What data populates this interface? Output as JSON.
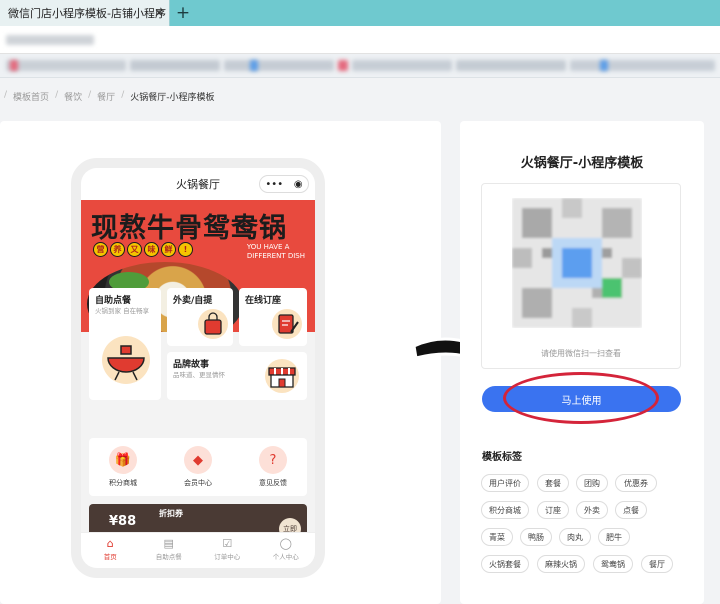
{
  "browser": {
    "tab_title": "微信门店小程序模板-店铺小程序",
    "tab_close": "✕",
    "new_tab": "+"
  },
  "breadcrumb": [
    "模板首页",
    "餐饮",
    "餐厅",
    "火锅餐厅-小程序模板"
  ],
  "phone": {
    "nav_title": "火锅餐厅",
    "capsule_more": "•••",
    "capsule_close": "◉",
    "banner": {
      "title": "现熬牛骨鸳鸯锅",
      "tags": [
        "营",
        "养",
        "又",
        "味",
        "鲜",
        "!"
      ],
      "en_line1": "YOU HAVE A",
      "en_line2": "DIFFERENT DISH"
    },
    "tiles": [
      {
        "title": "自助点餐",
        "sub": "火锅到家 自在畅享"
      },
      {
        "title": "外卖/自提",
        "sub": ""
      },
      {
        "title": "在线订座",
        "sub": ""
      },
      {
        "title": "品牌故事",
        "sub": "品味道、更显情怀"
      }
    ],
    "quick": [
      {
        "label": "积分商城",
        "icon": "gift-icon",
        "glyph": "🎁"
      },
      {
        "label": "会员中心",
        "icon": "diamond-icon",
        "glyph": "◆"
      },
      {
        "label": "意见反馈",
        "icon": "question-icon",
        "glyph": "?"
      }
    ],
    "coupon": {
      "value": "¥88",
      "title": "折扣券",
      "badge": "立即"
    },
    "tabbar": [
      {
        "label": "首页",
        "glyph": "⌂",
        "active": true
      },
      {
        "label": "自助点餐",
        "glyph": "▤",
        "active": false
      },
      {
        "label": "订单中心",
        "glyph": "☑",
        "active": false
      },
      {
        "label": "个人中心",
        "glyph": "◯",
        "active": false
      }
    ]
  },
  "info": {
    "title": "火锅餐厅-小程序模板",
    "qr_caption": "请使用微信扫一扫查看",
    "use_button": "马上使用",
    "tags_heading": "模板标签",
    "tags": [
      "用户评价",
      "套餐",
      "团购",
      "优惠券",
      "积分商城",
      "订座",
      "外卖",
      "点餐",
      "青菜",
      "鸭肠",
      "肉丸",
      "肥牛",
      "火锅套餐",
      "麻辣火锅",
      "鸳鸯锅",
      "餐厅"
    ]
  },
  "colors": {
    "brand_red": "#e84a3e",
    "button_blue": "#3a73f0",
    "annotation_red": "#d4243a",
    "tab_teal": "#6fc9cf"
  }
}
